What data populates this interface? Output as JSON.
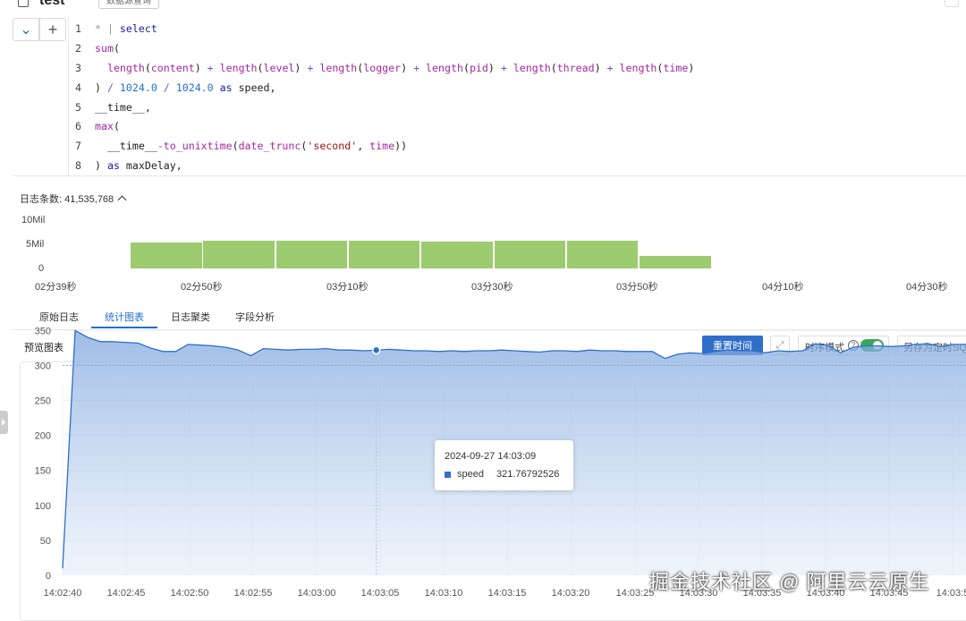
{
  "header": {
    "title": "test",
    "badge": "数据源查询"
  },
  "editor": {
    "lines": [
      {
        "n": "1",
        "tokens": [
          {
            "t": "* | ",
            "c": "lg"
          },
          {
            "t": "select",
            "c": "kw"
          }
        ]
      },
      {
        "n": "2",
        "tokens": [
          {
            "t": "sum",
            "c": "fn"
          },
          {
            "t": "(",
            "c": "id"
          }
        ]
      },
      {
        "n": "3",
        "tokens": [
          {
            "t": "  length",
            "c": "fn"
          },
          {
            "t": "(",
            "c": "id"
          },
          {
            "t": "content",
            "c": "fn"
          },
          {
            "t": ") ",
            "c": "id"
          },
          {
            "t": "+",
            "c": "op"
          },
          {
            "t": " length",
            "c": "fn"
          },
          {
            "t": "(",
            "c": "id"
          },
          {
            "t": "level",
            "c": "fn"
          },
          {
            "t": ") ",
            "c": "id"
          },
          {
            "t": "+",
            "c": "op"
          },
          {
            "t": " length",
            "c": "fn"
          },
          {
            "t": "(",
            "c": "id"
          },
          {
            "t": "logger",
            "c": "fn"
          },
          {
            "t": ") ",
            "c": "id"
          },
          {
            "t": "+",
            "c": "op"
          },
          {
            "t": " length",
            "c": "fn"
          },
          {
            "t": "(",
            "c": "id"
          },
          {
            "t": "pid",
            "c": "fn"
          },
          {
            "t": ") ",
            "c": "id"
          },
          {
            "t": "+",
            "c": "op"
          },
          {
            "t": " length",
            "c": "fn"
          },
          {
            "t": "(",
            "c": "id"
          },
          {
            "t": "thread",
            "c": "fn"
          },
          {
            "t": ") ",
            "c": "id"
          },
          {
            "t": "+",
            "c": "op"
          },
          {
            "t": " length",
            "c": "fn"
          },
          {
            "t": "(",
            "c": "id"
          },
          {
            "t": "time",
            "c": "fn"
          },
          {
            "t": ")",
            "c": "id"
          }
        ]
      },
      {
        "n": "4",
        "tokens": [
          {
            "t": ") ",
            "c": "id"
          },
          {
            "t": "/",
            "c": "op"
          },
          {
            "t": " 1024.0 ",
            "c": "num"
          },
          {
            "t": "/",
            "c": "op"
          },
          {
            "t": " 1024.0 ",
            "c": "num"
          },
          {
            "t": "as",
            "c": "kw"
          },
          {
            "t": " speed,",
            "c": "id"
          }
        ]
      },
      {
        "n": "5",
        "tokens": [
          {
            "t": "__time__,",
            "c": "id"
          }
        ]
      },
      {
        "n": "6",
        "tokens": [
          {
            "t": "max",
            "c": "fn"
          },
          {
            "t": "(",
            "c": "id"
          }
        ]
      },
      {
        "n": "7",
        "tokens": [
          {
            "t": "  __time__",
            "c": "id"
          },
          {
            "t": "-",
            "c": "op"
          },
          {
            "t": "to_unixtime",
            "c": "fn"
          },
          {
            "t": "(",
            "c": "id"
          },
          {
            "t": "date_trunc",
            "c": "fn"
          },
          {
            "t": "(",
            "c": "id"
          },
          {
            "t": "'second'",
            "c": "str"
          },
          {
            "t": ", ",
            "c": "id"
          },
          {
            "t": "time",
            "c": "fn"
          },
          {
            "t": "))",
            "c": "id"
          }
        ]
      },
      {
        "n": "8",
        "tokens": [
          {
            "t": ") ",
            "c": "id"
          },
          {
            "t": "as",
            "c": "kw"
          },
          {
            "t": " maxDelay,",
            "c": "id"
          }
        ]
      }
    ]
  },
  "histogram": {
    "count_label": "日志条数: 41,535,768",
    "y_ticks": [
      "10Mil",
      "5Mil",
      "0"
    ],
    "x_ticks": [
      "02分39秒",
      "02分50秒",
      "03分10秒",
      "03分30秒",
      "03分50秒",
      "04分10秒",
      "04分30秒"
    ],
    "bars_mil": [
      5.2,
      5.7,
      5.6,
      5.6,
      5.5,
      5.6,
      5.7,
      2.6
    ],
    "bar_color": "#9dcb6f"
  },
  "tabs": [
    {
      "label": "原始日志",
      "active": false
    },
    {
      "label": "统计图表",
      "active": true
    },
    {
      "label": "日志聚类",
      "active": false
    },
    {
      "label": "字段分析",
      "active": false
    }
  ],
  "preview": {
    "label": "预览图表",
    "reset_button": "重置时间",
    "ts_mode_label": "时序模式",
    "ts_mode_on": true,
    "save_button": "另存为定时SQL"
  },
  "chart_data": {
    "type": "area",
    "series": [
      {
        "name": "speed",
        "color": "#2f6fc9",
        "values": [
          10,
          350,
          340,
          334,
          334,
          333,
          332,
          325,
          320,
          320,
          330,
          329,
          328,
          326,
          322,
          314,
          324,
          323,
          322,
          323,
          323,
          324,
          322,
          322,
          321,
          321.77,
          323,
          322,
          321,
          321,
          320,
          321,
          320,
          321,
          321,
          322,
          321,
          320,
          319,
          321,
          321,
          320,
          322,
          321,
          321,
          320,
          320,
          320,
          310,
          316,
          318,
          317,
          320,
          322,
          321,
          321,
          318,
          321,
          320,
          321,
          331,
          329,
          318,
          326,
          328,
          328,
          327,
          328,
          330,
          331,
          327,
          330,
          330
        ]
      }
    ],
    "x_ticks": [
      "14:02:40",
      "14:02:45",
      "14:02:50",
      "14:02:55",
      "14:03:00",
      "14:03:05",
      "14:03:10",
      "14:03:15",
      "14:03:20",
      "14:03:25",
      "14:03:30",
      "14:03:35",
      "14:03:40",
      "14:03:45",
      "14:03:5"
    ],
    "y_ticks": [
      "350",
      "300",
      "250",
      "200",
      "150",
      "100",
      "50",
      "0"
    ],
    "ylim": [
      0,
      375
    ],
    "reference_line": 300,
    "tooltip": {
      "time": "2024-09-27 14:03:09",
      "series": "speed",
      "value": "321.76792526"
    }
  },
  "watermark": "掘金技术社区 @ 阿里云云原生"
}
